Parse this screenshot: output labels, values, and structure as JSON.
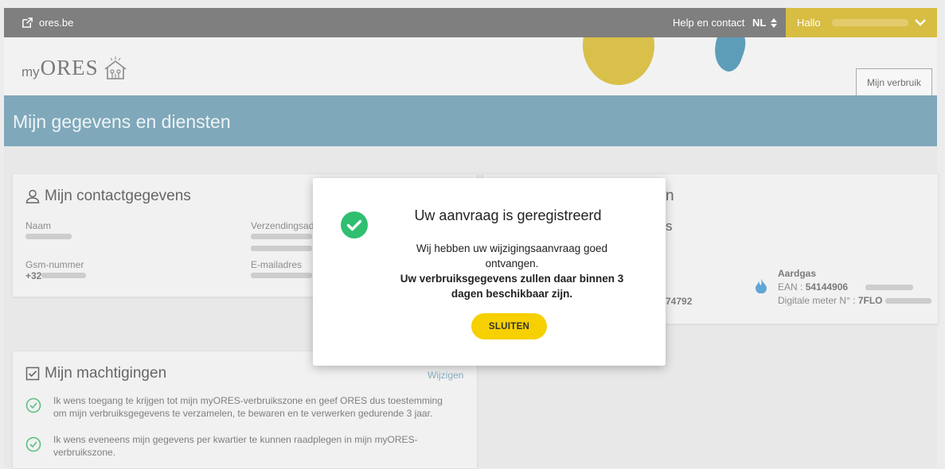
{
  "topbar": {
    "brand": "ores.be",
    "help": "Help en contact",
    "lang": "NL",
    "hello": "Hallo"
  },
  "header": {
    "logo_my": "my",
    "logo_ores": "ORES",
    "usage_button": "Mijn verbruik"
  },
  "banner": {
    "title": "Mijn gegevens en diensten"
  },
  "contact": {
    "title": "Mijn contactgegevens",
    "name_label": "Naam",
    "shipping_label": "Verzendingsad",
    "mobile_label": "Gsm-nummer",
    "mobile_prefix": "+32",
    "email_label": "E-mailadres"
  },
  "meters": {
    "title_fragment": "n",
    "s_fragment": "s",
    "number_fragment": "74792",
    "gas_title": "Aardgas",
    "ean_label": "EAN : ",
    "ean_value": "54144906",
    "meter_label": "Digitale meter N° : ",
    "meter_value": "7FLO"
  },
  "mandates": {
    "title": "Mijn machtigingen",
    "edit": "Wijzigen",
    "items": [
      "Ik wens toegang te krijgen tot mijn myORES-verbruikszone en geef ORES dus toestemming om mijn verbruiksgegevens te verzamelen, te bewaren en te verwerken gedurende 3 jaar.",
      "Ik wens eveneens mijn gegevens per kwartier te kunnen raadplegen in mijn myORES-verbruikszone."
    ]
  },
  "modal": {
    "title": "Uw aanvraag is geregistreerd",
    "message": "Wij hebben uw wijzigingsaanvraag goed ontvangen.",
    "message_bold": "Uw verbruiksgegevens zullen daar binnen 3 dagen beschikbaar zijn.",
    "close": "SLUITEN"
  },
  "colors": {
    "accent_yellow": "#f6d000",
    "banner_blue": "#7fa8ba",
    "success_green": "#2fbf71"
  },
  "icons": [
    "external-link-icon",
    "sort-arrows-icon",
    "chevron-down-icon",
    "house-logo-icon",
    "user-icon",
    "checkbox-icon",
    "check-circle-icon",
    "gas-drop-icon"
  ]
}
